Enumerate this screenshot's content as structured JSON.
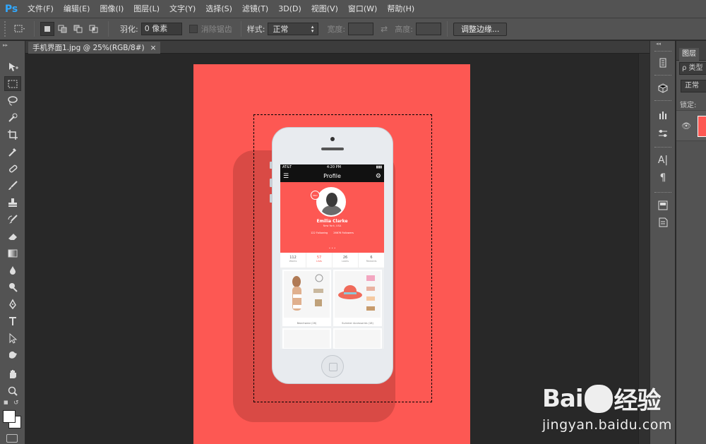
{
  "app": {
    "logo": "Ps"
  },
  "menu": [
    "文件(F)",
    "编辑(E)",
    "图像(I)",
    "图层(L)",
    "文字(Y)",
    "选择(S)",
    "滤镜(T)",
    "3D(D)",
    "视图(V)",
    "窗口(W)",
    "帮助(H)"
  ],
  "options": {
    "feather_label": "羽化:",
    "feather_value": "0 像素",
    "antialias_label": "消除锯齿",
    "style_label": "样式:",
    "style_value": "正常",
    "width_label": "宽度:",
    "height_label": "高度:",
    "refine_edge": "调整边缘..."
  },
  "document": {
    "tab_title": "手机界面1.jpg @ 25%(RGB/8#)",
    "close": "×",
    "background_color": "#fd5853"
  },
  "phone": {
    "status_carrier": "AT&T",
    "status_time": "4:20 PM",
    "status_right": "▮▮▮",
    "title": "Profile",
    "name": "Emilia Clarke",
    "location": "New York, USA",
    "following": "122 Following",
    "followers": "26676 Followers",
    "pro_badge": "PRO",
    "dots": "• • •",
    "stats": [
      {
        "n": "112",
        "l": "Wants"
      },
      {
        "n": "57",
        "l": "Lists"
      },
      {
        "n": "26",
        "l": "Looks"
      },
      {
        "n": "6",
        "l": "Rewards"
      }
    ],
    "cards": [
      {
        "caption": "Beachwear (26)"
      },
      {
        "caption": "Summer Accessories (18)"
      }
    ]
  },
  "panels": {
    "layers_tab": "图层",
    "search": "ρ 类型",
    "blend_mode": "正常",
    "lock_label": "锁定:"
  },
  "watermark": {
    "logo_left": "Bai",
    "logo_right": "经验",
    "url": "jingyan.baidu.com"
  },
  "icons": [
    "move-tool-icon",
    "marquee-tool-icon",
    "lasso-tool-icon",
    "quick-select-icon",
    "crop-tool-icon",
    "eyedropper-icon",
    "healing-brush-icon",
    "brush-tool-icon",
    "clone-stamp-icon",
    "history-brush-icon",
    "eraser-icon",
    "gradient-icon",
    "blur-icon",
    "dodge-icon",
    "pen-tool-icon",
    "type-tool-icon",
    "path-select-icon",
    "shape-tool-icon",
    "hand-tool-icon",
    "zoom-tool-icon"
  ]
}
